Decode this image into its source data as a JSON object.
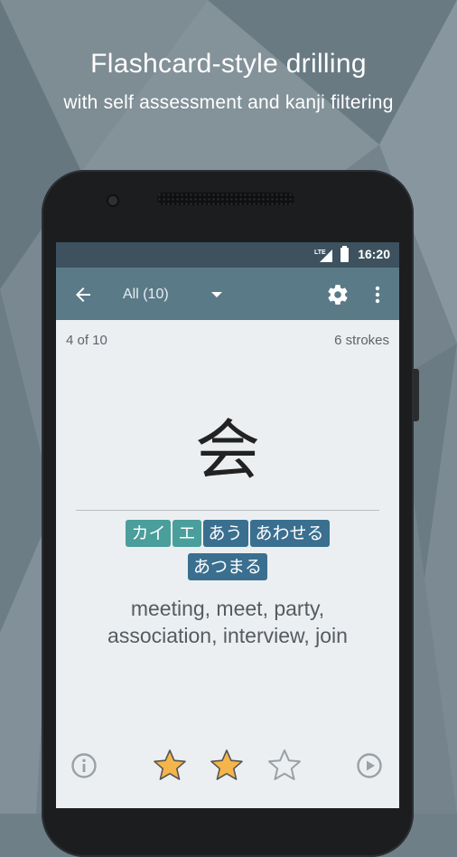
{
  "promo": {
    "title": "Flashcard-style drilling",
    "subtitle": "with self assessment and kanji filtering"
  },
  "statusbar": {
    "network": "LTE",
    "time": "16:20"
  },
  "toolbar": {
    "filter_label": "All (10)",
    "icons": [
      "back-arrow-icon",
      "dropdown-arrow-icon",
      "gear-icon",
      "more-vert-icon"
    ]
  },
  "card": {
    "counter": "4 of 10",
    "strokes": "6 strokes",
    "kanji": "会",
    "readings_on": [
      "カイ",
      "エ"
    ],
    "readings_kun": [
      "あう",
      "あわせる",
      "あつまる"
    ],
    "meaning": "meeting, meet, party, association, interview, join"
  },
  "bottom": {
    "rating": 2,
    "rating_max": 3,
    "icons": [
      "info-icon",
      "star-icon",
      "play-icon"
    ]
  },
  "colors": {
    "statusbar": "#3d525e",
    "toolbar": "#5b7a88",
    "screen_bg": "#eceff1",
    "on_reading": "#4a9e9b",
    "kun_reading": "#3a6f8f",
    "star_filled": "#f5b54a",
    "star_empty": "#9aa0a4"
  }
}
